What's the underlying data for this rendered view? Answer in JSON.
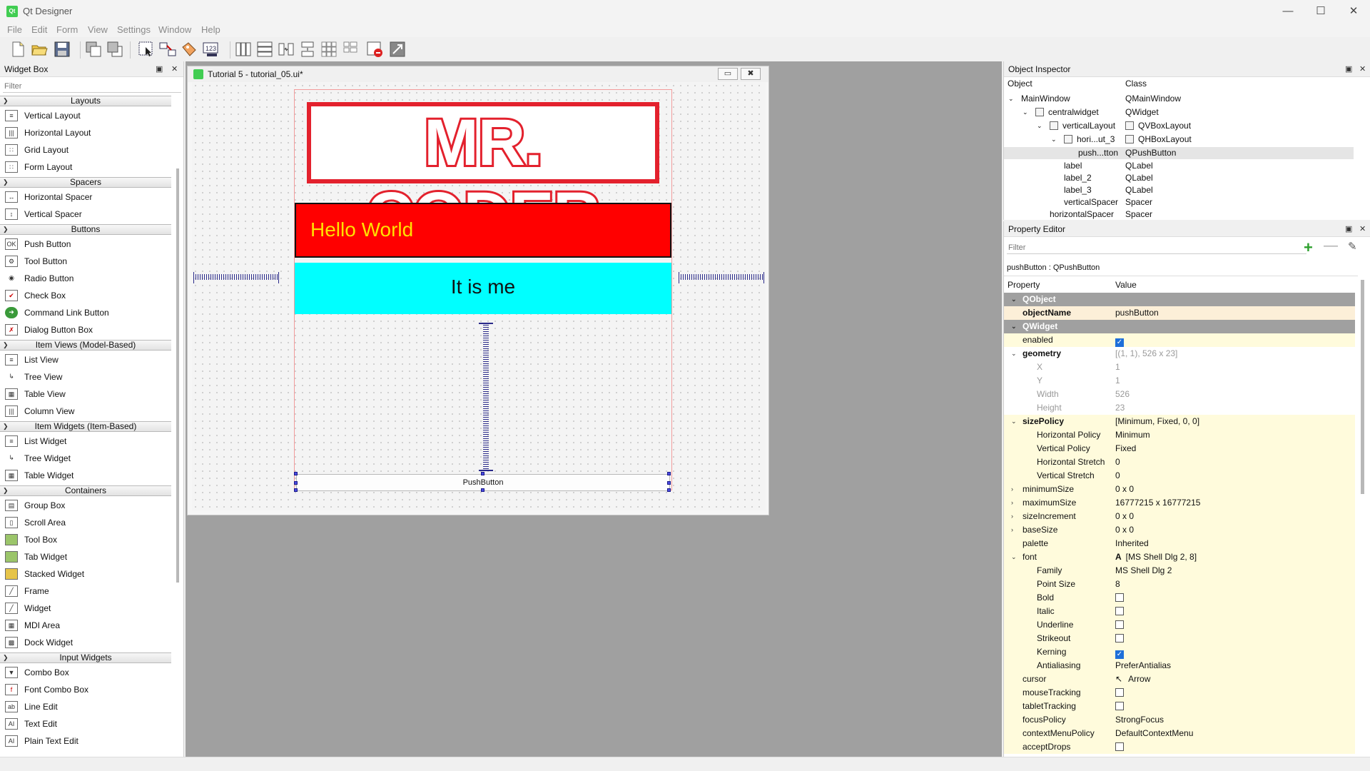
{
  "app": {
    "title": "Qt Designer",
    "icon_text": "Qt"
  },
  "menu": [
    "File",
    "Edit",
    "Form",
    "View",
    "Settings",
    "Window",
    "Help"
  ],
  "widget_box": {
    "title": "Widget Box",
    "filter_placeholder": "Filter",
    "categories": {
      "layouts": "Layouts",
      "spacers": "Spacers",
      "buttons": "Buttons",
      "item_views": "Item Views (Model-Based)",
      "item_widgets": "Item Widgets (Item-Based)",
      "containers": "Containers",
      "input_widgets": "Input Widgets"
    },
    "items": {
      "vertical_layout": "Vertical Layout",
      "horizontal_layout": "Horizontal Layout",
      "grid_layout": "Grid Layout",
      "form_layout": "Form Layout",
      "horizontal_spacer": "Horizontal Spacer",
      "vertical_spacer": "Vertical Spacer",
      "push_button": "Push Button",
      "tool_button": "Tool Button",
      "radio_button": "Radio Button",
      "check_box": "Check Box",
      "command_link_button": "Command Link Button",
      "dialog_button_box": "Dialog Button Box",
      "list_view": "List View",
      "tree_view": "Tree View",
      "table_view": "Table View",
      "column_view": "Column View",
      "list_widget": "List Widget",
      "tree_widget": "Tree Widget",
      "table_widget": "Table Widget",
      "group_box": "Group Box",
      "scroll_area": "Scroll Area",
      "tool_box": "Tool Box",
      "tab_widget": "Tab Widget",
      "stacked_widget": "Stacked Widget",
      "frame": "Frame",
      "widget": "Widget",
      "mdi_area": "MDI Area",
      "dock_widget": "Dock Widget",
      "combo_box": "Combo Box",
      "font_combo_box": "Font Combo Box",
      "line_edit": "Line Edit",
      "text_edit": "Text Edit",
      "plain_text_edit": "Plain Text Edit"
    }
  },
  "form": {
    "title": "Tutorial 5 - tutorial_05.ui*",
    "logo_text": "MR. CODER",
    "label_red": "Hello World",
    "label_cyan": "It is me",
    "push_button": "PushButton",
    "colors": {
      "red_bg": "#ff0000",
      "yellow_text": "#ffe100",
      "cyan_bg": "#00ffff",
      "logo_red": "#e3212d"
    }
  },
  "object_inspector": {
    "title": "Object Inspector",
    "col_object": "Object",
    "col_class": "Class",
    "rows": [
      {
        "name": "MainWindow",
        "cls": "QMainWindow"
      },
      {
        "name": "centralwidget",
        "cls": "QWidget"
      },
      {
        "name": "verticalLayout",
        "cls": "QVBoxLayout"
      },
      {
        "name": "hori...ut_3",
        "cls": "QHBoxLayout"
      },
      {
        "name": "push...tton",
        "cls": "QPushButton"
      },
      {
        "name": "label",
        "cls": "QLabel"
      },
      {
        "name": "label_2",
        "cls": "QLabel"
      },
      {
        "name": "label_3",
        "cls": "QLabel"
      },
      {
        "name": "verticalSpacer",
        "cls": "Spacer"
      },
      {
        "name": "horizontalSpacer",
        "cls": "Spacer"
      }
    ]
  },
  "property_editor": {
    "title": "Property Editor",
    "filter_placeholder": "Filter",
    "object_label": "pushButton : QPushButton",
    "col_property": "Property",
    "col_value": "Value",
    "rows": {
      "qobject": "QObject",
      "objectName": {
        "name": "objectName",
        "value": "pushButton"
      },
      "qwidget": "QWidget",
      "enabled": {
        "name": "enabled"
      },
      "geometry": {
        "name": "geometry",
        "value": "[(1, 1), 526 x 23]"
      },
      "x": {
        "name": "X",
        "value": "1"
      },
      "y": {
        "name": "Y",
        "value": "1"
      },
      "width": {
        "name": "Width",
        "value": "526"
      },
      "height": {
        "name": "Height",
        "value": "23"
      },
      "sizePolicy": {
        "name": "sizePolicy",
        "value": "[Minimum, Fixed, 0, 0]"
      },
      "hpolicy": {
        "name": "Horizontal Policy",
        "value": "Minimum"
      },
      "vpolicy": {
        "name": "Vertical Policy",
        "value": "Fixed"
      },
      "hstretch": {
        "name": "Horizontal Stretch",
        "value": "0"
      },
      "vstretch": {
        "name": "Vertical Stretch",
        "value": "0"
      },
      "minimumSize": {
        "name": "minimumSize",
        "value": "0 x 0"
      },
      "maximumSize": {
        "name": "maximumSize",
        "value": "16777215 x 16777215"
      },
      "sizeIncrement": {
        "name": "sizeIncrement",
        "value": "0 x 0"
      },
      "baseSize": {
        "name": "baseSize",
        "value": "0 x 0"
      },
      "palette": {
        "name": "palette",
        "value": "Inherited"
      },
      "font": {
        "name": "font",
        "value": "[MS Shell Dlg 2, 8]"
      },
      "family": {
        "name": "Family",
        "value": "MS Shell Dlg 2"
      },
      "pointSize": {
        "name": "Point Size",
        "value": "8"
      },
      "bold": {
        "name": "Bold"
      },
      "italic": {
        "name": "Italic"
      },
      "underline": {
        "name": "Underline"
      },
      "strikeout": {
        "name": "Strikeout"
      },
      "kerning": {
        "name": "Kerning"
      },
      "antialiasing": {
        "name": "Antialiasing",
        "value": "PreferAntialias"
      },
      "cursor": {
        "name": "cursor",
        "value": "Arrow"
      },
      "mouseTracking": {
        "name": "mouseTracking"
      },
      "tabletTracking": {
        "name": "tabletTracking"
      },
      "focusPolicy": {
        "name": "focusPolicy",
        "value": "StrongFocus"
      },
      "contextMenuPolicy": {
        "name": "contextMenuPolicy",
        "value": "DefaultContextMenu"
      },
      "acceptDrops": {
        "name": "acceptDrops"
      }
    }
  }
}
